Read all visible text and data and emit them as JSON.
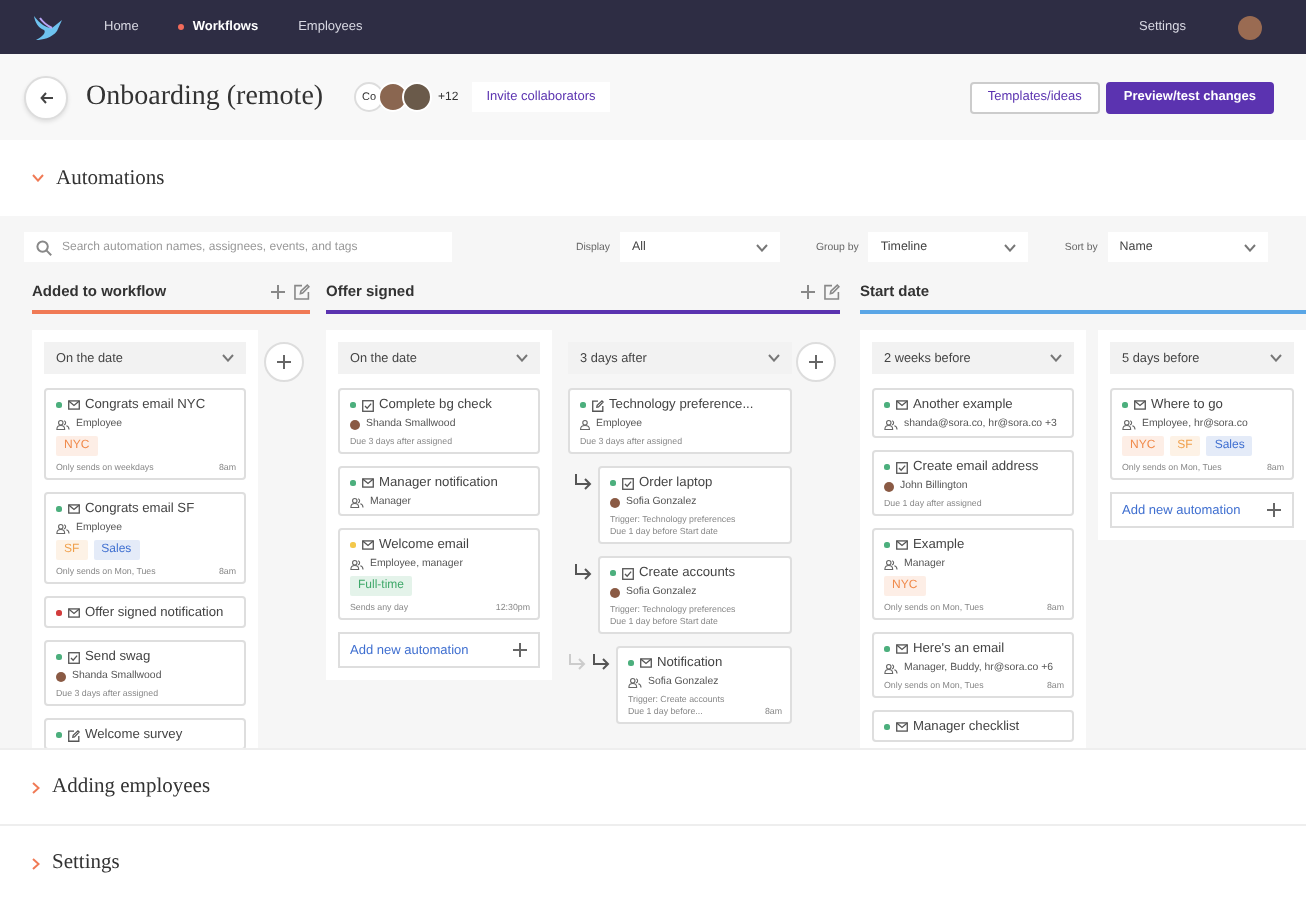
{
  "nav": {
    "items": [
      {
        "label": "Home",
        "selected": false
      },
      {
        "label": "Workflows",
        "selected": true
      },
      {
        "label": "Employees",
        "selected": false
      }
    ],
    "settings": "Settings"
  },
  "header": {
    "title": "Onboarding (remote)",
    "collaborators": {
      "initials": "Co",
      "more": "+12"
    },
    "invite": "Invite collaborators",
    "buttons": [
      {
        "label": "Templates/ideas",
        "kind": "secondary"
      },
      {
        "label": "Preview/test changes",
        "kind": "primary"
      }
    ]
  },
  "sections": [
    {
      "title": "Automations",
      "expanded": true,
      "filters": {
        "search_placeholder": "Search automation names, assignees, events, and tags",
        "selects": [
          {
            "label": "Display",
            "value": "All"
          },
          {
            "label": "Group by",
            "value": "Timeline"
          },
          {
            "label": "Sort by",
            "value": "Name"
          }
        ]
      },
      "groups": [
        {
          "title": "Added to workflow",
          "color": "#f07a55",
          "editable": true,
          "addable": true,
          "columns": [
            {
              "timing": "On the date",
              "kind": "panel",
              "cards": [
                {
                  "title": "Congrats email NYC",
                  "color": "#4caf7d",
                  "kind": "email",
                  "assignee": {
                    "kind": "group",
                    "text": "Employee"
                  },
                  "tags": [
                    {
                      "label": "NYC",
                      "color": "#f08a4b"
                    }
                  ],
                  "notes": [
                    "Only sends on weekdays"
                  ],
                  "time": "8am"
                },
                {
                  "title": "Congrats email SF",
                  "color": "#4caf7d",
                  "kind": "email",
                  "assignee": {
                    "kind": "group",
                    "text": "Employee"
                  },
                  "tags": [
                    {
                      "label": "SF",
                      "color": "#f0a04b"
                    },
                    {
                      "label": "Sales",
                      "color": "#3f6fd0"
                    }
                  ],
                  "notes": [
                    "Only sends on Mon, Tues"
                  ],
                  "time": "8am"
                },
                {
                  "title": "Offer signed notification",
                  "color": "#d23c3c",
                  "kind": "email"
                },
                {
                  "title": "Send swag",
                  "color": "#4caf7d",
                  "kind": "task",
                  "assignee": {
                    "kind": "avatar",
                    "text": "Shanda Smallwood"
                  },
                  "notes": [
                    "Due 3 days after assigned"
                  ]
                },
                {
                  "title": "Welcome survey",
                  "color": "#4caf7d",
                  "kind": "survey"
                }
              ]
            }
          ]
        },
        {
          "title": "Offer signed",
          "color": "#5b33b0",
          "editable": true,
          "addable": true,
          "columns": [
            {
              "timing": "On the date",
              "kind": "panel",
              "add_label": "Add new automation",
              "cards": [
                {
                  "title": "Complete bg check",
                  "color": "#4caf7d",
                  "kind": "task",
                  "assignee": {
                    "kind": "avatar",
                    "text": "Shanda Smallwood"
                  },
                  "notes": [
                    "Due 3 days after assigned"
                  ]
                },
                {
                  "title": "Manager notification",
                  "color": "#4caf7d",
                  "kind": "email",
                  "assignee": {
                    "kind": "group",
                    "text": "Manager"
                  }
                },
                {
                  "title": "Welcome email",
                  "color": "#f3c84b",
                  "kind": "email",
                  "assignee": {
                    "kind": "group",
                    "text": "Employee, manager"
                  },
                  "tags": [
                    {
                      "label": "Full-time",
                      "color": "#3fa86a"
                    }
                  ],
                  "notes": [
                    "Sends any day"
                  ],
                  "time": "12:30pm"
                }
              ]
            },
            {
              "timing": "3 days after",
              "kind": "chain",
              "cards": [
                {
                  "title": "Technology preference...",
                  "color": "#4caf7d",
                  "kind": "survey",
                  "assignee": {
                    "kind": "person",
                    "text": "Employee"
                  },
                  "notes": [
                    "Due 3 days after assigned"
                  ],
                  "children": [
                    {
                      "title": "Order laptop",
                      "color": "#4caf7d",
                      "kind": "task",
                      "assignee": {
                        "kind": "avatar",
                        "text": "Sofia Gonzalez"
                      },
                      "notes": [
                        "Trigger: Technology preferences",
                        "Due 1 day before Start date"
                      ]
                    },
                    {
                      "title": "Create accounts",
                      "color": "#4caf7d",
                      "kind": "task",
                      "assignee": {
                        "kind": "avatar",
                        "text": "Sofia Gonzalez"
                      },
                      "notes": [
                        "Trigger: Technology preferences",
                        "Due 1 day before Start date"
                      ],
                      "children": [
                        {
                          "title": "Notification",
                          "color": "#4caf7d",
                          "kind": "email",
                          "assignee": {
                            "kind": "group",
                            "text": "Sofia Gonzalez"
                          },
                          "notes": [
                            "Trigger: Create accounts",
                            "Due 1 day before..."
                          ],
                          "time": "8am"
                        }
                      ]
                    }
                  ]
                }
              ]
            }
          ]
        },
        {
          "title": "Start date",
          "color": "#5aa6e6",
          "editable": false,
          "addable": false,
          "columns": [
            {
              "timing": "2 weeks before",
              "kind": "panel",
              "cards": [
                {
                  "title": "Another example",
                  "color": "#4caf7d",
                  "kind": "email",
                  "assignee": {
                    "kind": "group",
                    "text": "shanda@sora.co, hr@sora.co +3"
                  }
                },
                {
                  "title": "Create email address",
                  "color": "#4caf7d",
                  "kind": "task",
                  "assignee": {
                    "kind": "avatar",
                    "text": "John Billington"
                  },
                  "notes": [
                    "Due 1 day after assigned"
                  ]
                },
                {
                  "title": "Example",
                  "color": "#4caf7d",
                  "kind": "email",
                  "assignee": {
                    "kind": "group",
                    "text": "Manager"
                  },
                  "tags": [
                    {
                      "label": "NYC",
                      "color": "#f08a4b"
                    }
                  ],
                  "notes": [
                    "Only sends on Mon, Tues"
                  ],
                  "time": "8am"
                },
                {
                  "title": "Here's an email",
                  "color": "#4caf7d",
                  "kind": "email",
                  "assignee": {
                    "kind": "group",
                    "text": "Manager, Buddy, hr@sora.co +6"
                  },
                  "notes": [
                    "Only sends on Mon, Tues"
                  ],
                  "time": "8am"
                },
                {
                  "title": "Manager checklist",
                  "color": "#4caf7d",
                  "kind": "email"
                }
              ]
            },
            {
              "timing": "5 days before",
              "kind": "panel",
              "add_label": "Add new automation",
              "cards": [
                {
                  "title": "Where to go",
                  "color": "#4caf7d",
                  "kind": "email",
                  "assignee": {
                    "kind": "group",
                    "text": "Employee, hr@sora.co"
                  },
                  "tags": [
                    {
                      "label": "NYC",
                      "color": "#f08a4b"
                    },
                    {
                      "label": "SF",
                      "color": "#f0a04b"
                    },
                    {
                      "label": "Sales",
                      "color": "#3f6fd0"
                    }
                  ],
                  "notes": [
                    "Only sends on Mon, Tues"
                  ],
                  "time": "8am"
                }
              ]
            }
          ]
        }
      ]
    },
    {
      "title": "Adding employees",
      "expanded": false
    },
    {
      "title": "Settings",
      "expanded": false
    }
  ]
}
